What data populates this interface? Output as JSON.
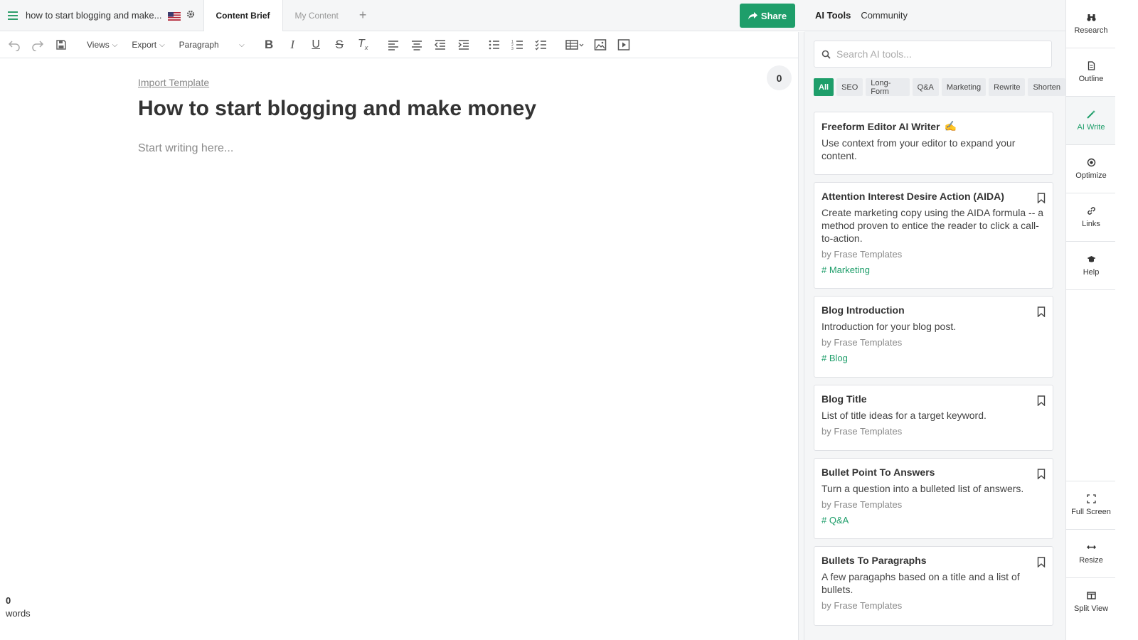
{
  "topbar": {
    "doc_title": "how to start blogging and make...",
    "tabs": [
      {
        "label": "Content Brief"
      },
      {
        "label": "My Content"
      }
    ],
    "add_tab": "+",
    "share_label": "Share"
  },
  "toolbar": {
    "views_label": "Views",
    "export_label": "Export",
    "paragraph_label": "Paragraph"
  },
  "editor": {
    "import_template": "Import Template",
    "counter": "0",
    "heading": "How to start blogging and make money",
    "placeholder": "Start writing here...",
    "word_count": "0",
    "word_label": "words"
  },
  "rpanel": {
    "tabs": [
      {
        "label": "AI Tools"
      },
      {
        "label": "Community"
      }
    ],
    "search_placeholder": "Search AI tools...",
    "filters": [
      "All",
      "SEO",
      "Long-Form",
      "Q&A",
      "Marketing",
      "Rewrite",
      "Shorten"
    ],
    "cards": [
      {
        "title": "Freeform Editor AI Writer",
        "emoji": "✍️",
        "desc": "Use context from your editor to expand your content.",
        "author": "",
        "tag": ""
      },
      {
        "title": "Attention Interest Desire Action (AIDA)",
        "desc": "Create marketing copy using the AIDA formula -- a method proven to entice the reader to click a call-to-action.",
        "author": "by Frase Templates",
        "tag": "# Marketing"
      },
      {
        "title": "Blog Introduction",
        "desc": "Introduction for your blog post.",
        "author": "by Frase Templates",
        "tag": "# Blog"
      },
      {
        "title": "Blog Title",
        "desc": "List of title ideas for a target keyword.",
        "author": "by Frase Templates",
        "tag": ""
      },
      {
        "title": "Bullet Point To Answers",
        "desc": "Turn a question into a bulleted list of answers.",
        "author": "by Frase Templates",
        "tag": "# Q&A"
      },
      {
        "title": "Bullets To Paragraphs",
        "desc": "A few paragaphs based on a title and a list of bullets.",
        "author": "by Frase Templates",
        "tag": ""
      }
    ]
  },
  "sidebar": {
    "items": [
      {
        "label": "Research"
      },
      {
        "label": "Outline"
      },
      {
        "label": "AI Write"
      },
      {
        "label": "Optimize"
      },
      {
        "label": "Links"
      },
      {
        "label": "Help"
      }
    ],
    "bottom": [
      {
        "label": "Full Screen"
      },
      {
        "label": "Resize"
      },
      {
        "label": "Split View"
      }
    ]
  },
  "colors": {
    "accent": "#1e9e6a",
    "panel_bg": "#f5f6f7"
  }
}
